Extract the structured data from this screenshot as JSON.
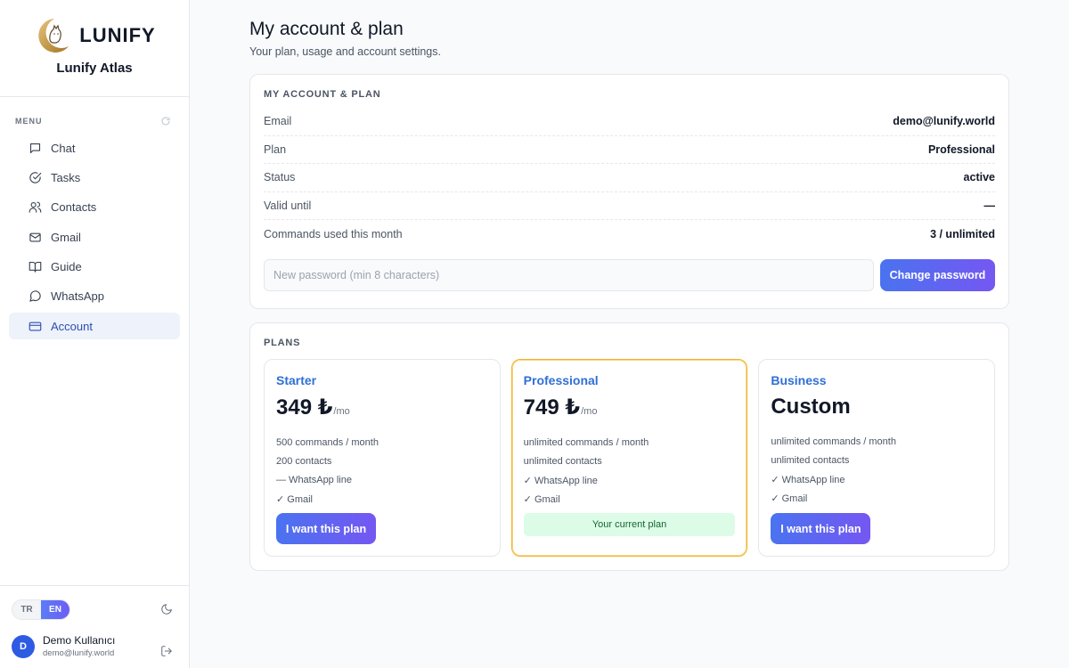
{
  "brand": {
    "logo_text": "LUNIFY",
    "app_name": "Lunify Atlas"
  },
  "sidebar": {
    "menu_label": "MENU",
    "items": [
      {
        "label": "Chat",
        "icon": "chat-icon"
      },
      {
        "label": "Tasks",
        "icon": "check-circle-icon"
      },
      {
        "label": "Contacts",
        "icon": "users-icon"
      },
      {
        "label": "Gmail",
        "icon": "mail-icon"
      },
      {
        "label": "Guide",
        "icon": "book-icon"
      },
      {
        "label": "WhatsApp",
        "icon": "message-circle-icon"
      },
      {
        "label": "Account",
        "icon": "credit-card-icon",
        "active": true
      }
    ],
    "lang": {
      "tr": "TR",
      "en": "EN",
      "active": "EN"
    },
    "user": {
      "initial": "D",
      "name": "Demo Kullanıcı",
      "email": "demo@lunify.world"
    }
  },
  "page": {
    "title": "My account & plan",
    "subtitle": "Your plan, usage and account settings."
  },
  "account": {
    "section_title": "MY ACCOUNT & PLAN",
    "rows": [
      {
        "label": "Email",
        "value": "demo@lunify.world"
      },
      {
        "label": "Plan",
        "value": "Professional"
      },
      {
        "label": "Status",
        "value": "active"
      },
      {
        "label": "Valid until",
        "value": "—"
      },
      {
        "label": "Commands used this month",
        "value": "3 / unlimited"
      }
    ],
    "password_placeholder": "New password (min 8 characters)",
    "change_password_label": "Change password"
  },
  "plans": {
    "section_title": "PLANS",
    "items": [
      {
        "name": "Starter",
        "price": "349 ₺",
        "per": "/mo",
        "features": [
          "500 commands / month",
          "200 contacts",
          "— WhatsApp line",
          "✓ Gmail"
        ],
        "button": "I want this plan"
      },
      {
        "name": "Professional",
        "price": "749 ₺",
        "per": "/mo",
        "features": [
          "unlimited commands / month",
          "unlimited contacts",
          "✓ WhatsApp line",
          "✓ Gmail"
        ],
        "badge": "Your current plan"
      },
      {
        "name": "Business",
        "price": "Custom",
        "per": "",
        "features": [
          "unlimited commands / month",
          "unlimited contacts",
          "✓ WhatsApp line",
          "✓ Gmail"
        ],
        "button": "I want this plan"
      }
    ]
  },
  "colors": {
    "accent_start": "#4a73f0",
    "accent_end": "#7557f2",
    "plan_name": "#2f6fd6",
    "current_border": "#f0b429",
    "badge_bg": "#dcfce7"
  }
}
